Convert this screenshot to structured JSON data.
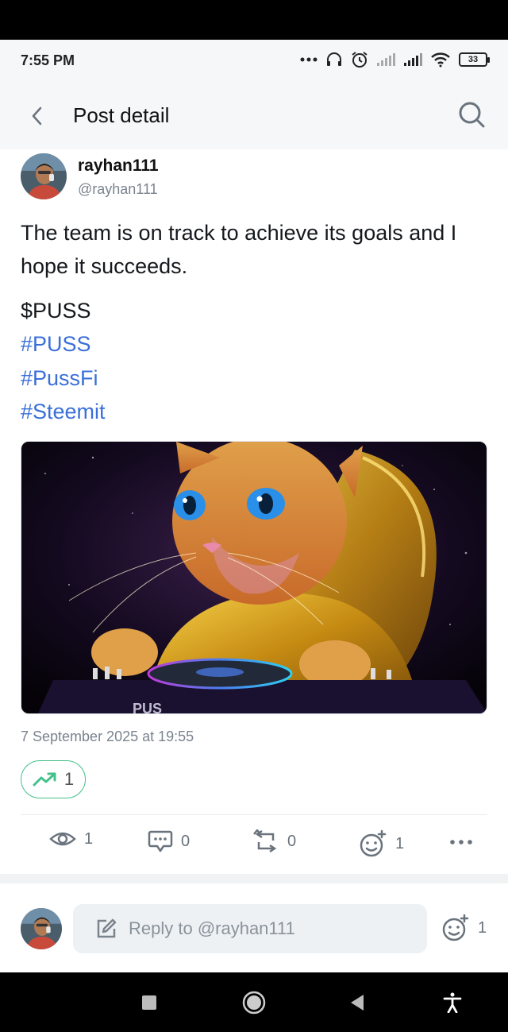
{
  "status_bar": {
    "time": "7:55 PM",
    "battery": "33",
    "icons": [
      "more-dots-icon",
      "headset-icon",
      "alarm-icon",
      "signal-weak-icon",
      "signal-icon",
      "wifi-icon",
      "battery-icon"
    ]
  },
  "header": {
    "title": "Post detail",
    "back_icon": "chevron-left-icon",
    "search_icon": "search-icon"
  },
  "author": {
    "name": "rayhan111",
    "handle": "@rayhan111"
  },
  "post": {
    "text": "The team is on track to achieve its goals and I hope it succeeds.",
    "ticker": "$PUSS",
    "tags": [
      "#PUSS",
      "#PussFi",
      "#Steemit"
    ],
    "timestamp": "7 September 2025 at 19:55",
    "trend_count": "1"
  },
  "actions": {
    "views": "1",
    "comments": "0",
    "reposts": "0",
    "reactions": "1"
  },
  "reply": {
    "placeholder": "Reply to @rayhan111",
    "reactions": "1"
  },
  "colors": {
    "link": "#3b6fd8",
    "trend_green": "#44c08a",
    "muted": "#7a838e"
  }
}
